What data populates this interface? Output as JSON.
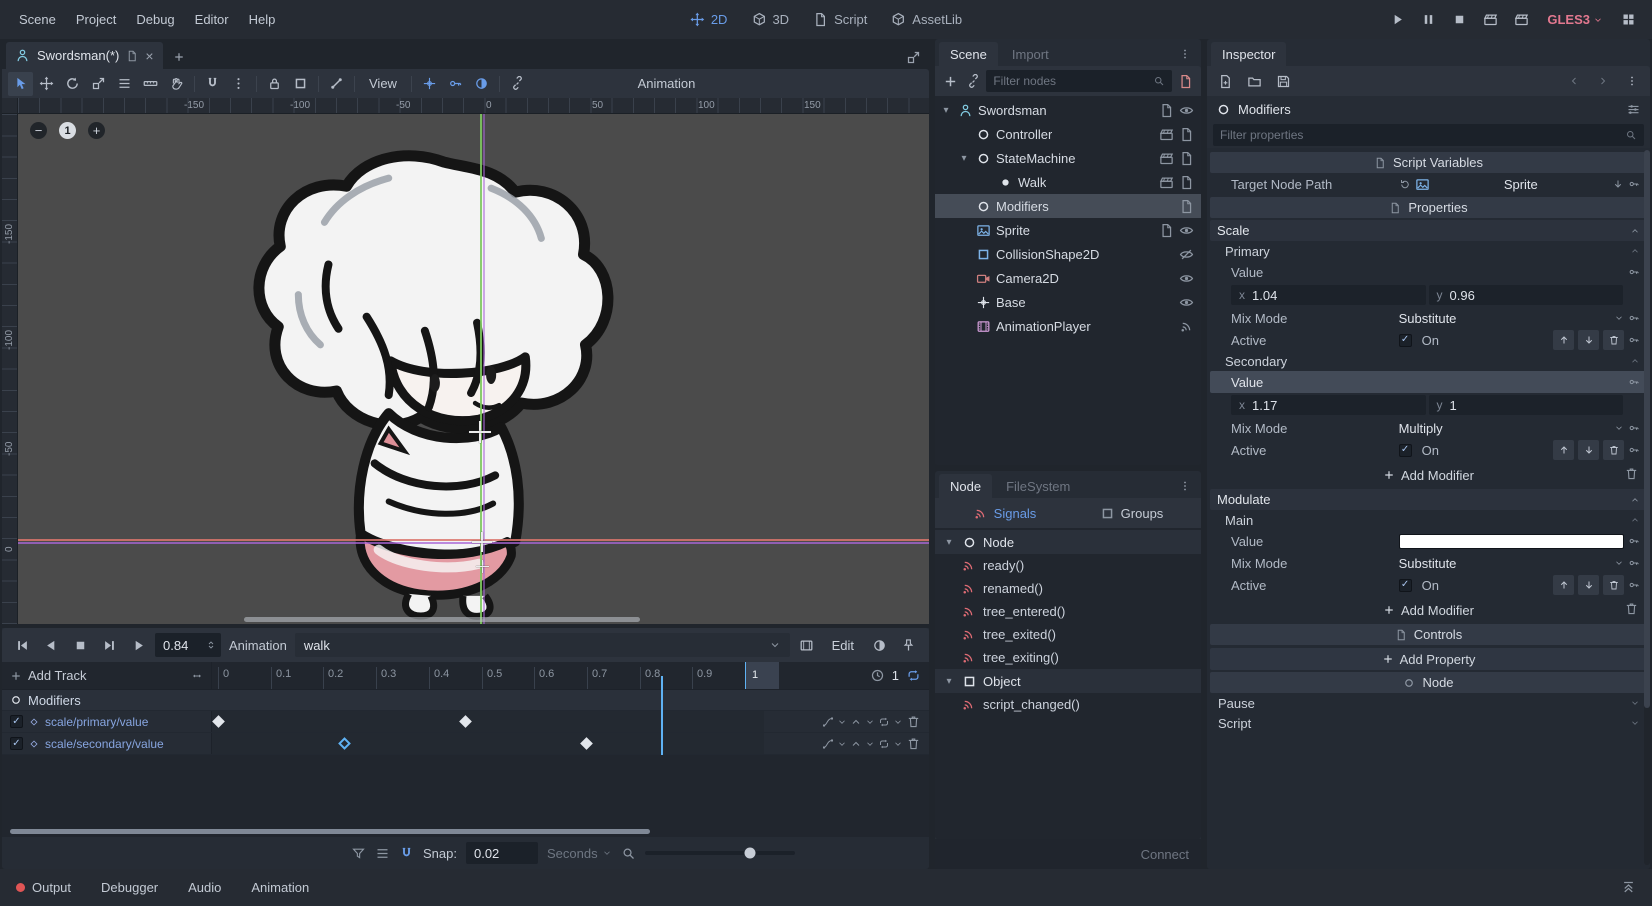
{
  "colors": {
    "accent": "#699ce8",
    "axis_x": "#da766c",
    "axis_y": "#7dc85f",
    "viewport_bounds": "#a866d7",
    "renderer_label": "#e2788f",
    "signal_icon": "#e06c75"
  },
  "icons": {
    "workspace_2d": "move-icon",
    "workspace_3d": "cube-icon",
    "workspace_script": "script-icon",
    "workspace_assetlib": "box-icon",
    "search": "search-icon",
    "key": "key-icon",
    "trash": "trash-icon"
  },
  "menubar": {
    "menus": [
      "Scene",
      "Project",
      "Debug",
      "Editor",
      "Help"
    ],
    "workspaces": [
      "2D",
      "3D",
      "Script",
      "AssetLib"
    ],
    "active_workspace": "2D",
    "renderer": "GLES3"
  },
  "scene_tab_bar": {
    "tabs": [
      {
        "label": "Swordsman(*)"
      }
    ]
  },
  "viewport": {
    "toolbar": {
      "view": "View",
      "context": "Animation"
    },
    "zoom_reset": "1",
    "ruler_top": [
      "-150",
      "-100",
      "-50",
      "0",
      "50",
      "100",
      "150"
    ],
    "ruler_left": [
      "-150",
      "-100",
      "-50",
      "0"
    ]
  },
  "animation": {
    "time": "0.84",
    "playhead": 0.84,
    "label": "Animation",
    "current": "walk",
    "edit": "Edit",
    "add_track": "Add Track",
    "ticks": [
      "0",
      "0.1",
      "0.2",
      "0.3",
      "0.4",
      "0.5",
      "0.6",
      "0.7",
      "0.8",
      "0.9"
    ],
    "end_tick": "1",
    "length": "1",
    "group": "Modifiers",
    "tracks": [
      {
        "name": "scale/primary/value",
        "keys": [
          {
            "t": 0.0,
            "style": "filled"
          },
          {
            "t": 0.47,
            "style": "filled"
          }
        ]
      },
      {
        "name": "scale/secondary/value",
        "keys": [
          {
            "t": 0.24,
            "style": "hollow"
          },
          {
            "t": 0.7,
            "style": "filled"
          }
        ]
      }
    ],
    "snap_label": "Snap:",
    "snap_value": "0.02",
    "units": "Seconds"
  },
  "bottom_bar": {
    "tabs": [
      "Output",
      "Debugger",
      "Audio",
      "Animation"
    ],
    "active": "Animation"
  },
  "scene_panel": {
    "tabs": [
      "Scene",
      "Import"
    ],
    "filter_placeholder": "Filter nodes",
    "tree": [
      {
        "name": "Swordsman"
      },
      {
        "name": "Controller"
      },
      {
        "name": "StateMachine"
      },
      {
        "name": "Walk"
      },
      {
        "name": "Modifiers"
      },
      {
        "name": "Sprite"
      },
      {
        "name": "CollisionShape2D"
      },
      {
        "name": "Camera2D"
      },
      {
        "name": "Base"
      },
      {
        "name": "AnimationPlayer"
      }
    ]
  },
  "node_panel": {
    "tabs": [
      "Node",
      "FileSystem"
    ],
    "signals_tab": "Signals",
    "groups_tab": "Groups",
    "sections": [
      {
        "name": "Node",
        "signals": [
          "ready()",
          "renamed()",
          "tree_entered()",
          "tree_exited()",
          "tree_exiting()"
        ]
      },
      {
        "name": "Object",
        "signals": [
          "script_changed()"
        ]
      }
    ],
    "connect": "Connect"
  },
  "inspector": {
    "tab": "Inspector",
    "object": "Modifiers",
    "filter_placeholder": "Filter properties",
    "script_variables": "Script Variables",
    "target_node_path": {
      "label": "Target Node Path",
      "value": "Sprite"
    },
    "properties": "Properties",
    "axis_x": "x",
    "axis_y": "y",
    "scale": {
      "title": "Scale",
      "primary": {
        "title": "Primary",
        "value_label": "Value",
        "x": "1.04",
        "y": "0.96",
        "mix_label": "Mix Mode",
        "mix": "Substitute",
        "active_label": "Active",
        "active": "On"
      },
      "secondary": {
        "title": "Secondary",
        "value_label": "Value",
        "x": "1.17",
        "y": "1",
        "mix_label": "Mix Mode",
        "mix": "Multiply",
        "active_label": "Active",
        "active": "On"
      },
      "add_modifier": "Add Modifier"
    },
    "modulate": {
      "title": "Modulate",
      "main": {
        "title": "Main",
        "value_label": "Value",
        "color": "#ffffff",
        "mix_label": "Mix Mode",
        "mix": "Substitute",
        "active_label": "Active",
        "active": "On"
      },
      "add_modifier": "Add Modifier"
    },
    "controls": "Controls",
    "add_property": "Add Property",
    "node_section": "Node",
    "pause": "Pause",
    "script": "Script"
  }
}
